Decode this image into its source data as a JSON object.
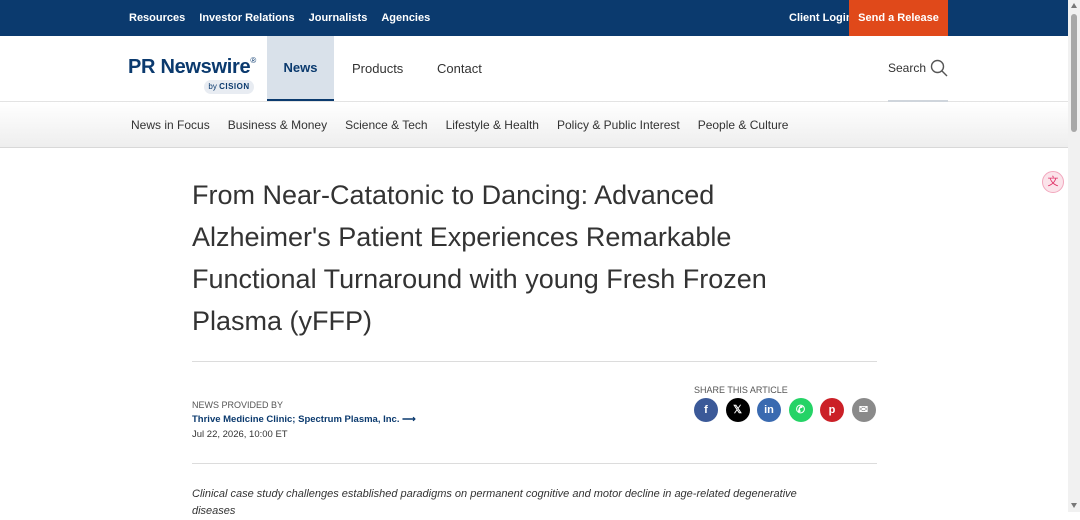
{
  "topbar": {
    "links": [
      "Resources",
      "Investor Relations",
      "Journalists",
      "Agencies"
    ],
    "client_login": "Client Login",
    "send_release": "Send a Release"
  },
  "header": {
    "logo_text": "PR Newswire",
    "logo_reg": "®",
    "logo_by": "by",
    "logo_cision": "CISION",
    "nav": {
      "news": "News",
      "products": "Products",
      "contact": "Contact"
    },
    "search_label": "Search"
  },
  "categories": [
    "News in Focus",
    "Business & Money",
    "Science & Tech",
    "Lifestyle & Health",
    "Policy & Public Interest",
    "People & Culture"
  ],
  "article": {
    "title": "From Near-Catatonic to Dancing: Advanced Alzheimer's Patient Experiences Remarkable Functional Turnaround with young Fresh Frozen Plasma (yFFP)",
    "provided_label": "NEWS PROVIDED BY",
    "company": "Thrive Medicine Clinic; Spectrum Plasma, Inc. ⟶",
    "dateline": "Jul 22, 2026, 10:00 ET",
    "share_label": "SHARE THIS ARTICLE",
    "subhead": "Clinical case study challenges established paradigms on permanent cognitive and motor decline in age-related degenerative diseases"
  },
  "share_icons": [
    {
      "name": "facebook-icon",
      "glyph": "f",
      "color": "#3b5998"
    },
    {
      "name": "x-icon",
      "glyph": "𝕏",
      "color": "#000000"
    },
    {
      "name": "linkedin-icon",
      "glyph": "in",
      "color": "#3a6ab0"
    },
    {
      "name": "whatsapp-icon",
      "glyph": "✆",
      "color": "#25d366"
    },
    {
      "name": "pinterest-icon",
      "glyph": "p",
      "color": "#cb2027"
    },
    {
      "name": "email-icon",
      "glyph": "✉",
      "color": "#8a8a8a"
    }
  ],
  "colors": {
    "brand_navy": "#0b3a6e",
    "accent_orange": "#e0491a"
  }
}
